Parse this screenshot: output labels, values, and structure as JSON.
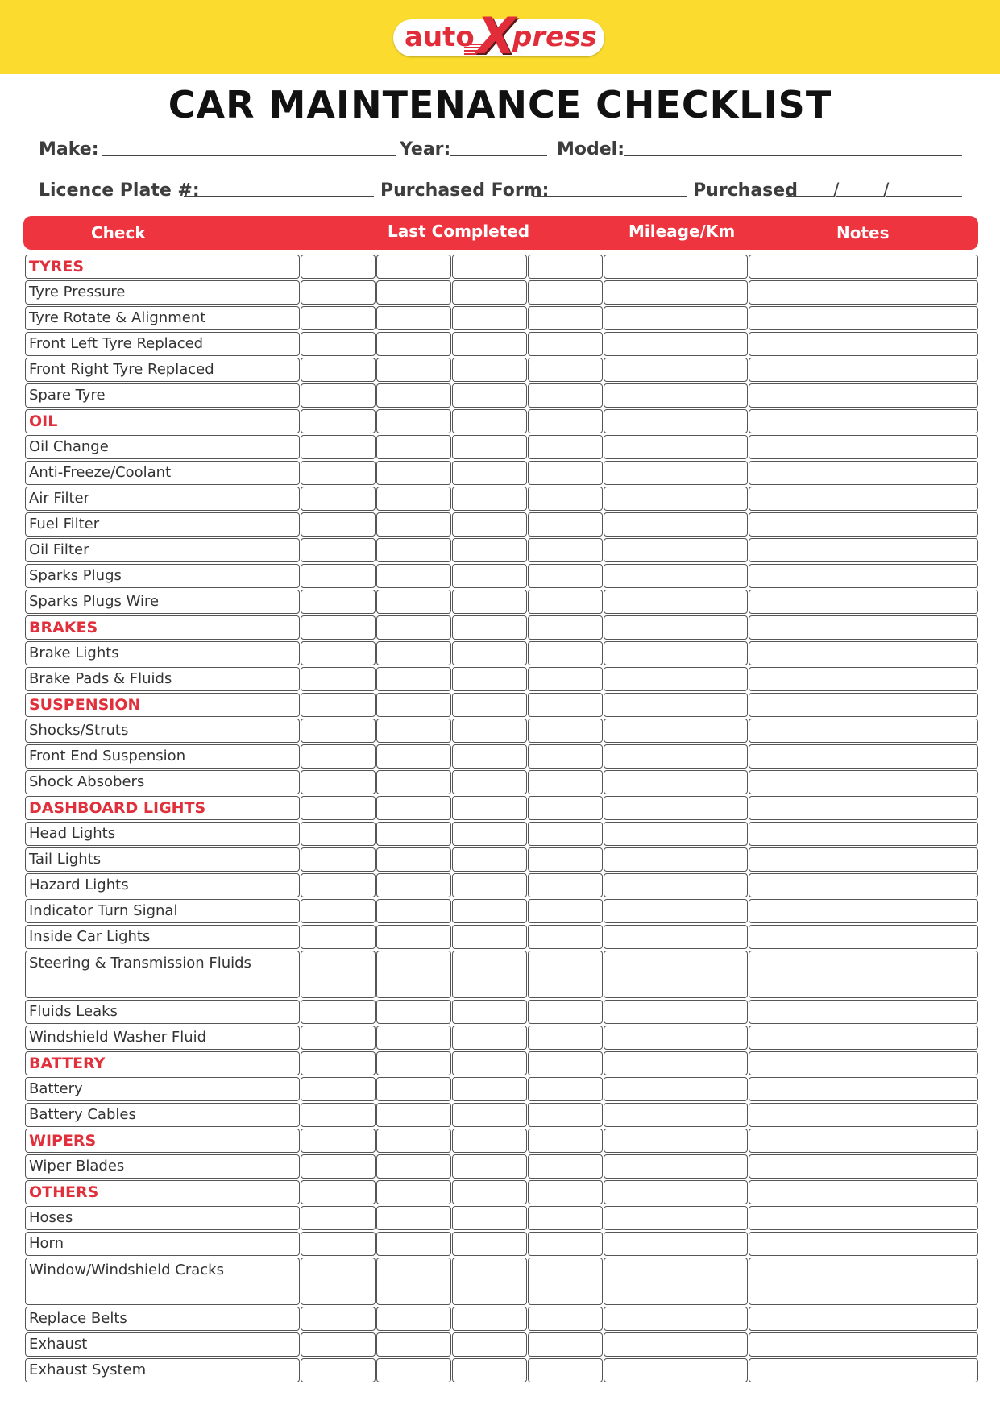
{
  "brand": {
    "logo_left": "auto",
    "logo_x": "X",
    "logo_right": "press",
    "colors": {
      "banner": "#fbdc2e",
      "accent": "#ee343e",
      "section_text": "#e0303c"
    }
  },
  "title": "CAR MAINTENANCE CHECKLIST",
  "fields": {
    "make_label": "Make:",
    "year_label": "Year:",
    "model_label": "Model:",
    "plate_label": "Licence Plate #:",
    "purchased_form_label": "Purchased Form:",
    "purchased_label": "Purchased",
    "date_separator": "/"
  },
  "table": {
    "headers": [
      "Check",
      "Last Completed",
      "Mileage/Km",
      "Notes"
    ],
    "rows": [
      {
        "label": "TYRES",
        "section": true
      },
      {
        "label": "Tyre Pressure"
      },
      {
        "label": "Tyre Rotate & Alignment"
      },
      {
        "label": "Front Left Tyre Replaced"
      },
      {
        "label": "Front Right Tyre Replaced"
      },
      {
        "label": "Spare Tyre"
      },
      {
        "label": "OIL",
        "section": true
      },
      {
        "label": "Oil Change"
      },
      {
        "label": "Anti-Freeze/Coolant"
      },
      {
        "label": "Air Filter"
      },
      {
        "label": "Fuel Filter"
      },
      {
        "label": "Oil Filter"
      },
      {
        "label": "Sparks Plugs"
      },
      {
        "label": "Sparks Plugs Wire"
      },
      {
        "label": "BRAKES",
        "section": true
      },
      {
        "label": "Brake Lights"
      },
      {
        "label": "Brake Pads & Fluids"
      },
      {
        "label": "SUSPENSION",
        "section": true
      },
      {
        "label": "Shocks/Struts"
      },
      {
        "label": "Front End Suspension"
      },
      {
        "label": "Shock Absobers"
      },
      {
        "label": "DASHBOARD LIGHTS",
        "section": true
      },
      {
        "label": "Head Lights"
      },
      {
        "label": "Tail Lights"
      },
      {
        "label": "Hazard Lights"
      },
      {
        "label": "Indicator Turn Signal"
      },
      {
        "label": "Inside Car Lights"
      },
      {
        "label": "Steering & Transmission Fluids",
        "double": true
      },
      {
        "label": "Fluids Leaks"
      },
      {
        "label": "Windshield Washer Fluid"
      },
      {
        "label": "BATTERY",
        "section": true
      },
      {
        "label": "Battery"
      },
      {
        "label": "Battery Cables"
      },
      {
        "label": "WIPERS",
        "section": true
      },
      {
        "label": "Wiper Blades"
      },
      {
        "label": "OTHERS",
        "section": true
      },
      {
        "label": "Hoses"
      },
      {
        "label": "Horn"
      },
      {
        "label": "Window/Windshield Cracks",
        "double": true
      },
      {
        "label": "Replace Belts"
      },
      {
        "label": "Exhaust"
      },
      {
        "label": "Exhaust System"
      }
    ]
  }
}
